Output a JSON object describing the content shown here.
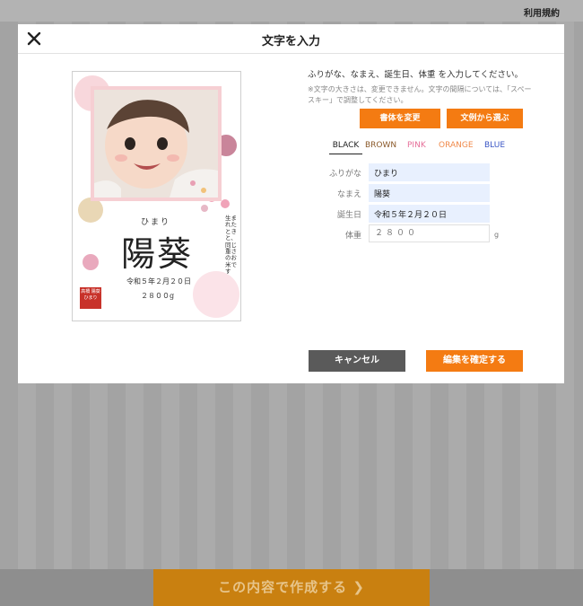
{
  "header": {
    "terms_link": "利用規約"
  },
  "footer": {
    "create_button": "この内容で作成する ❯"
  },
  "modal": {
    "title": "文字を入力",
    "instruction": "ふりがな、なまえ、誕生日、体重 を入力してください。",
    "note": "※文字の大きさは、変更できません。文字の間隔については、「スペースキー」で調整してください。",
    "font_button": "書体を変更",
    "example_button": "文例から選ぶ",
    "color_tabs": [
      "BLACK",
      "BROWN",
      "PINK",
      "ORANGE",
      "BLUE"
    ],
    "fields": [
      {
        "label": "ふりがな",
        "value": "ひまり"
      },
      {
        "label": "なまえ",
        "value": "陽葵"
      },
      {
        "label": "誕生日",
        "value": "令和５年２月２０日"
      },
      {
        "label": "体重",
        "placeholder": "２８００"
      }
    ],
    "weight_unit": "g",
    "cancel_button": "キャンセル",
    "confirm_button": "編集を確定する"
  },
  "card": {
    "name_kana": "ひまり",
    "name_kanji": "陽葵",
    "birthday": "令和５年２月２０日",
    "weight": "２８００g",
    "message": "生まれたときと、同じ重さのお米です",
    "stamp": "高橋 陽葵 ひまり",
    "accent_color": "#f6cfd3"
  },
  "colors": {
    "accent": "#f47b12",
    "cancel": "#5a5a5a"
  }
}
